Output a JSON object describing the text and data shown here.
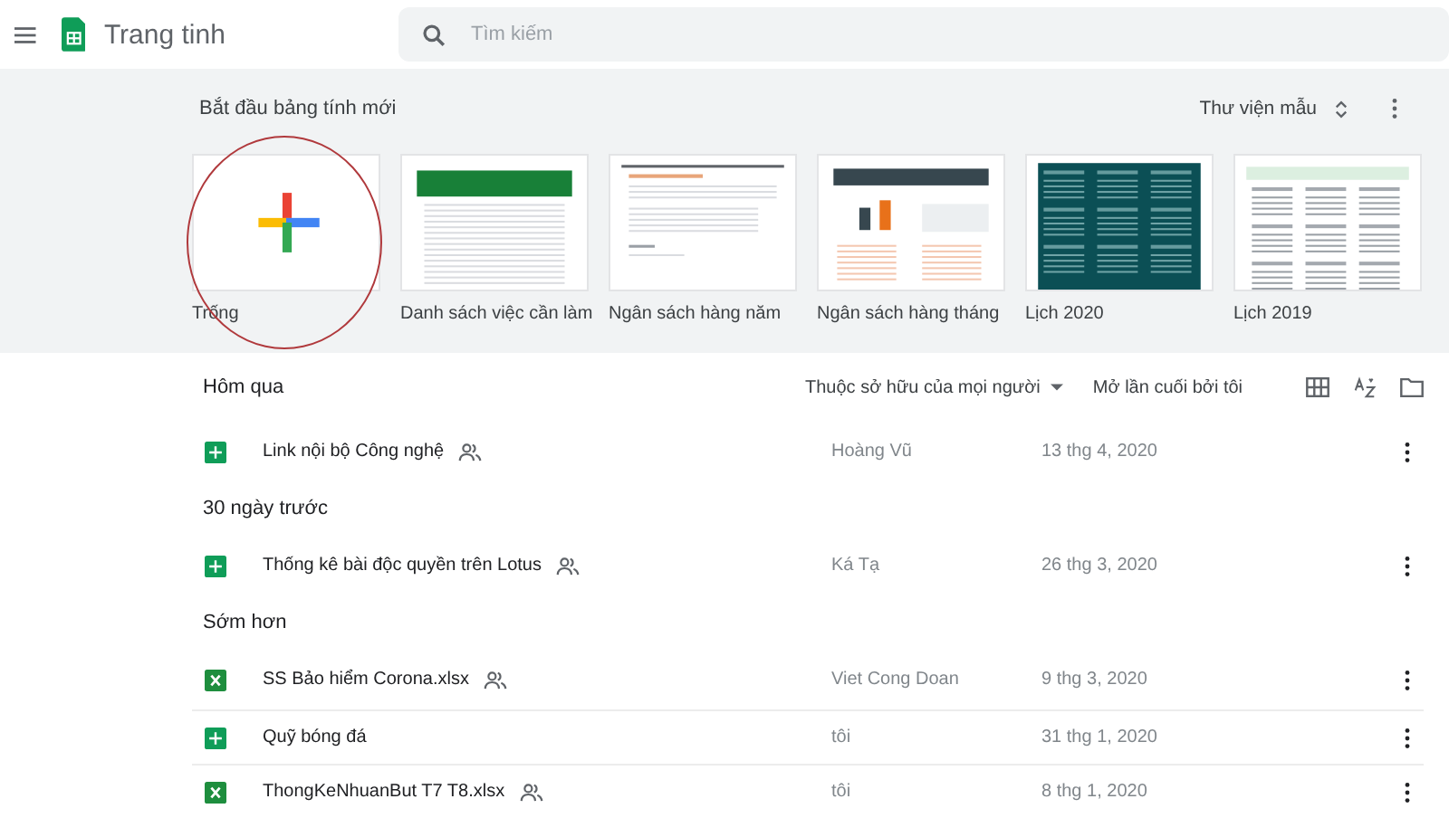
{
  "app": {
    "title": "Trang tinh"
  },
  "search": {
    "placeholder": "Tìm kiếm"
  },
  "templates": {
    "heading": "Bắt đầu bảng tính mới",
    "gallery_label": "Thư viện mẫu",
    "items": [
      {
        "kind": "blank",
        "label": "Trống",
        "circled": true
      },
      {
        "kind": "todo",
        "label": "Danh sách việc cần làm",
        "circled": false
      },
      {
        "kind": "annual",
        "label": "Ngân sách hàng năm",
        "circled": false
      },
      {
        "kind": "monthly",
        "label": "Ngân sách hàng tháng",
        "circled": false
      },
      {
        "kind": "calendar_dark",
        "label": "Lịch 2020",
        "circled": false
      },
      {
        "kind": "calendar_light",
        "label": "Lịch 2019",
        "circled": false
      }
    ]
  },
  "list": {
    "owner_filter": "Thuộc sở hữu của mọi người",
    "sort_label": "Mở lần cuối bởi tôi",
    "groups": [
      {
        "heading": "Hôm qua",
        "files": [
          {
            "kind": "sheet",
            "name": "Link nội bộ Công nghệ",
            "shared": true,
            "owner": "Hoàng Vũ",
            "date": "13 thg 4, 2020"
          }
        ]
      },
      {
        "heading": "30 ngày trước",
        "files": [
          {
            "kind": "sheet",
            "name": "Thống kê bài độc quyền trên Lotus",
            "shared": true,
            "owner": "Ká Tạ",
            "date": "26 thg 3, 2020"
          }
        ]
      },
      {
        "heading": "Sớm hơn",
        "files": [
          {
            "kind": "excel",
            "name": "SS Bảo hiểm Corona.xlsx",
            "shared": true,
            "owner": "Viet Cong Doan",
            "date": "9 thg 3, 2020"
          },
          {
            "kind": "sheet",
            "name": "Quỹ bóng đá",
            "shared": false,
            "owner": "tôi",
            "date": "31 thg 1, 2020"
          },
          {
            "kind": "excel",
            "name": "ThongKeNhuanBut T7 T8.xlsx",
            "shared": true,
            "owner": "tôi",
            "date": "8 thg 1, 2020"
          }
        ]
      }
    ]
  }
}
